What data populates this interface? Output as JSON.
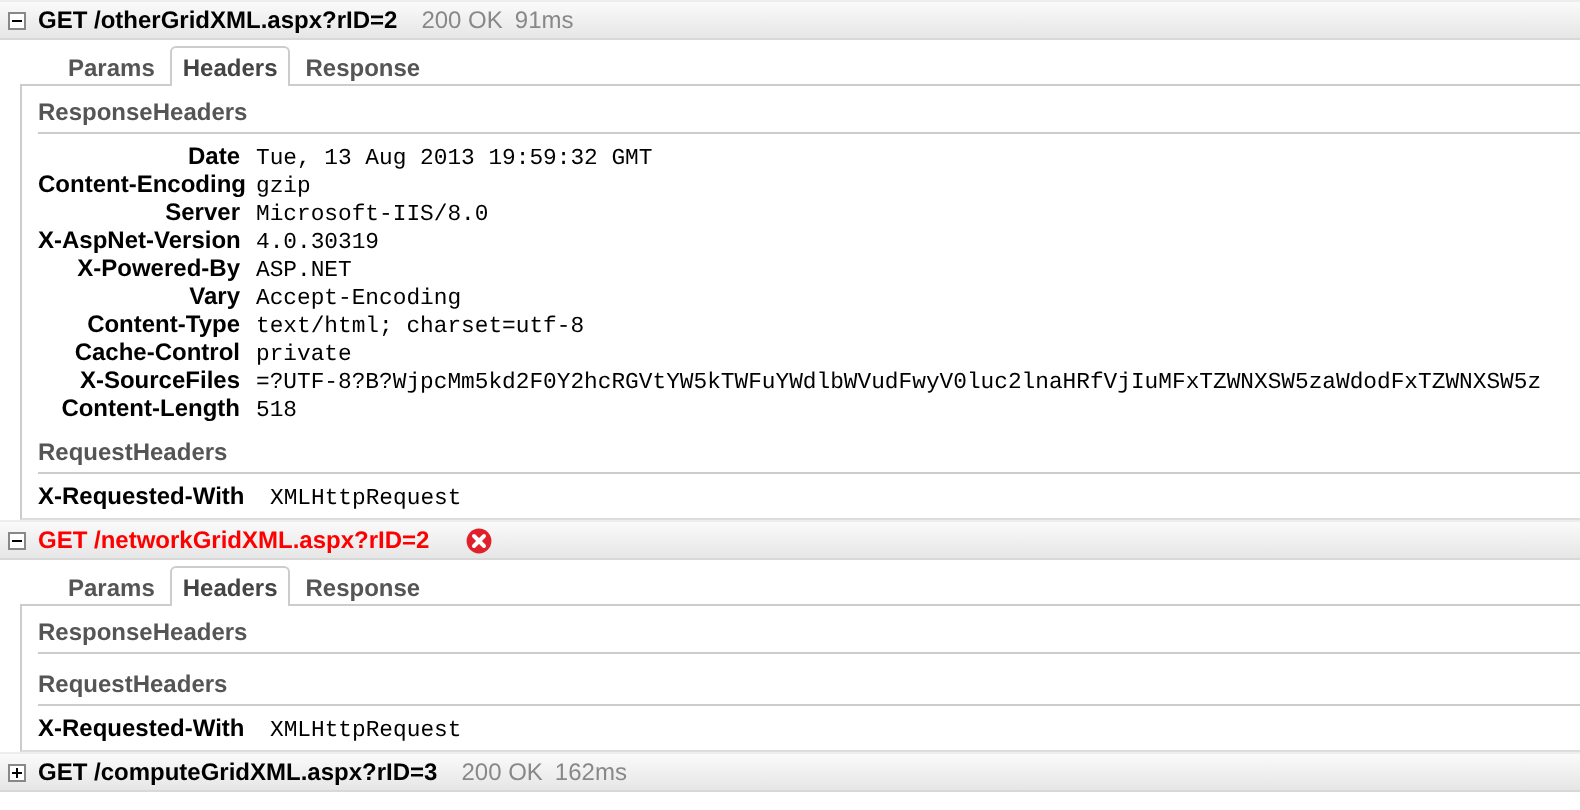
{
  "requests": [
    {
      "method": "GET",
      "url": "/otherGridXML.aspx?rID=2",
      "status": "200 OK",
      "time": "91ms",
      "error": false,
      "expanded": true,
      "tabs": [
        {
          "label": "Params",
          "selected": false
        },
        {
          "label": "Headers",
          "selected": true
        },
        {
          "label": "Response",
          "selected": false
        }
      ],
      "sections": [
        {
          "title": "ResponseHeaders",
          "headers": [
            {
              "name": "Date",
              "value": "Tue, 13 Aug 2013 19:59:32 GMT"
            },
            {
              "name": "Content-Encoding",
              "value": "gzip"
            },
            {
              "name": "Server",
              "value": "Microsoft-IIS/8.0"
            },
            {
              "name": "X-AspNet-Version",
              "value": "4.0.30319"
            },
            {
              "name": "X-Powered-By",
              "value": "ASP.NET"
            },
            {
              "name": "Vary",
              "value": "Accept-Encoding"
            },
            {
              "name": "Content-Type",
              "value": "text/html; charset=utf-8"
            },
            {
              "name": "Cache-Control",
              "value": "private"
            },
            {
              "name": "X-SourceFiles",
              "value": "=?UTF-8?B?WjpcMm5kd2F0Y2hcRGVtYW5kTWFuYWdlbWVudFwyV0luc2lnaHRfVjIuMFxTZWNXSW5zaWdodFxTZWNXSW5z"
            },
            {
              "name": "Content-Length",
              "value": "518"
            }
          ]
        },
        {
          "title": "RequestHeaders",
          "headers": [
            {
              "name": "X-Requested-With",
              "value": "XMLHttpRequest"
            }
          ]
        }
      ]
    },
    {
      "method": "GET",
      "url": "/networkGridXML.aspx?rID=2",
      "error": true,
      "expanded": true,
      "tabs": [
        {
          "label": "Params",
          "selected": false
        },
        {
          "label": "Headers",
          "selected": true
        },
        {
          "label": "Response",
          "selected": false
        }
      ],
      "sections": [
        {
          "title": "ResponseHeaders"
        },
        {
          "title": "RequestHeaders",
          "headers": [
            {
              "name": "X-Requested-With",
              "value": "XMLHttpRequest"
            }
          ]
        }
      ]
    },
    {
      "method": "GET",
      "url": "/computeGridXML.aspx?rID=3",
      "status": "200 OK",
      "time": "162ms",
      "error": false,
      "expanded": false
    }
  ]
}
